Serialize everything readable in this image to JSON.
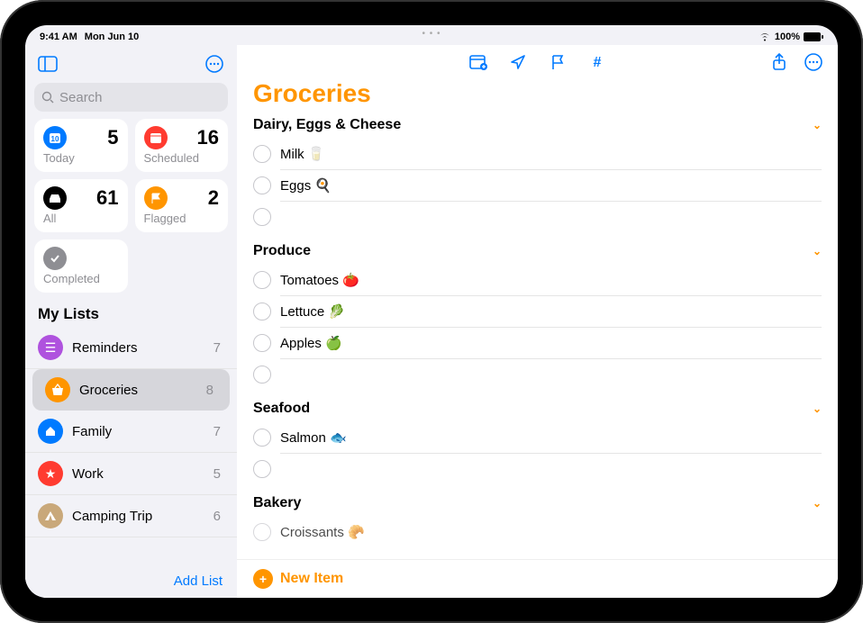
{
  "statusbar": {
    "time": "9:41 AM",
    "date": "Mon Jun 10",
    "battery": "100%"
  },
  "search": {
    "placeholder": "Search"
  },
  "smartcards": {
    "today": {
      "label": "Today",
      "count": "5"
    },
    "scheduled": {
      "label": "Scheduled",
      "count": "16"
    },
    "all": {
      "label": "All",
      "count": "61"
    },
    "flagged": {
      "label": "Flagged",
      "count": "2"
    },
    "completed": {
      "label": "Completed"
    }
  },
  "mylists_header": "My Lists",
  "lists": [
    {
      "name": "Reminders",
      "count": "7"
    },
    {
      "name": "Groceries",
      "count": "8"
    },
    {
      "name": "Family",
      "count": "7"
    },
    {
      "name": "Work",
      "count": "5"
    },
    {
      "name": "Camping Trip",
      "count": "6"
    }
  ],
  "sidebar_footer": "Add List",
  "main": {
    "title": "Groceries",
    "sections": [
      {
        "title": "Dairy, Eggs & Cheese",
        "items": [
          "Milk 🥛",
          "Eggs 🍳"
        ]
      },
      {
        "title": "Produce",
        "items": [
          "Tomatoes 🍅",
          "Lettuce 🥬",
          "Apples 🍏"
        ]
      },
      {
        "title": "Seafood",
        "items": [
          "Salmon 🐟"
        ]
      },
      {
        "title": "Bakery",
        "items": [
          "Croissants 🥐"
        ]
      }
    ],
    "new_item": "New Item"
  }
}
